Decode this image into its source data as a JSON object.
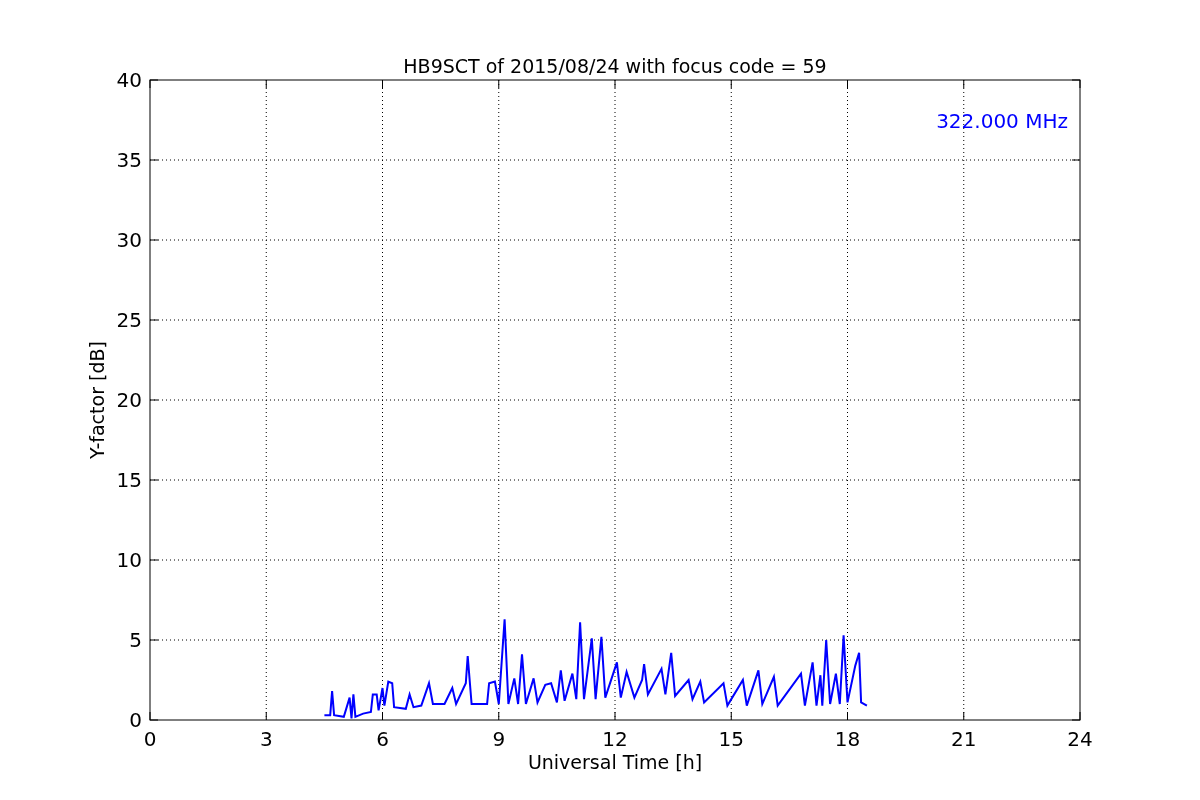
{
  "chart_data": {
    "type": "line",
    "title": "HB9SCT of 2015/08/24 with focus code = 59",
    "xlabel": "Universal Time [h]",
    "ylabel": "Y-factor [dB]",
    "x": [
      4.5,
      4.65,
      4.7,
      4.75,
      5.0,
      5.15,
      5.2,
      5.25,
      5.3,
      5.5,
      5.7,
      5.75,
      5.85,
      5.9,
      6.0,
      6.05,
      6.15,
      6.25,
      6.3,
      6.6,
      6.7,
      6.8,
      7.0,
      7.2,
      7.3,
      7.6,
      7.8,
      7.9,
      8.15,
      8.2,
      8.3,
      8.7,
      8.75,
      8.9,
      9.0,
      9.15,
      9.25,
      9.4,
      9.5,
      9.6,
      9.7,
      9.9,
      10.0,
      10.2,
      10.35,
      10.5,
      10.6,
      10.7,
      10.9,
      11.0,
      11.1,
      11.2,
      11.4,
      11.5,
      11.65,
      11.75,
      12.05,
      12.15,
      12.3,
      12.5,
      12.7,
      12.75,
      12.85,
      13.2,
      13.3,
      13.45,
      13.55,
      13.9,
      14.0,
      14.2,
      14.3,
      14.8,
      14.9,
      15.3,
      15.4,
      15.7,
      15.8,
      16.1,
      16.2,
      16.8,
      16.9,
      17.1,
      17.2,
      17.3,
      17.35,
      17.45,
      17.55,
      17.7,
      17.8,
      17.9,
      18.0,
      18.2,
      18.3,
      18.35,
      18.5
    ],
    "series": [
      {
        "name": "322.000 MHz",
        "color": "#0000ff",
        "values": [
          0.3,
          0.3,
          1.8,
          0.3,
          0.2,
          1.4,
          0.1,
          1.6,
          0.2,
          0.4,
          0.5,
          1.6,
          1.6,
          0.6,
          2.0,
          0.9,
          2.4,
          2.3,
          0.8,
          0.7,
          1.6,
          0.8,
          0.9,
          2.3,
          1.0,
          1.0,
          2.0,
          1.0,
          2.3,
          4.0,
          1.0,
          1.0,
          2.3,
          2.4,
          1.0,
          6.3,
          1.0,
          2.6,
          1.0,
          4.1,
          1.0,
          2.6,
          1.1,
          2.2,
          2.3,
          1.1,
          3.1,
          1.2,
          2.9,
          1.3,
          6.1,
          1.3,
          5.1,
          1.3,
          5.2,
          1.4,
          3.6,
          1.4,
          3.0,
          1.4,
          2.5,
          3.5,
          1.6,
          3.2,
          1.6,
          4.2,
          1.5,
          2.5,
          1.3,
          2.4,
          1.1,
          2.3,
          0.9,
          2.5,
          0.9,
          3.1,
          1.0,
          2.7,
          0.9,
          2.9,
          0.9,
          3.6,
          0.9,
          2.8,
          0.9,
          5.0,
          1.0,
          2.9,
          1.0,
          5.3,
          1.1,
          3.4,
          4.2,
          1.1,
          0.9
        ]
      }
    ],
    "xlim": [
      0,
      24
    ],
    "ylim": [
      0,
      40
    ],
    "xticks": [
      0,
      3,
      6,
      9,
      12,
      15,
      18,
      21,
      24
    ],
    "yticks": [
      0,
      5,
      10,
      15,
      20,
      25,
      30,
      35,
      40
    ],
    "grid": true
  }
}
